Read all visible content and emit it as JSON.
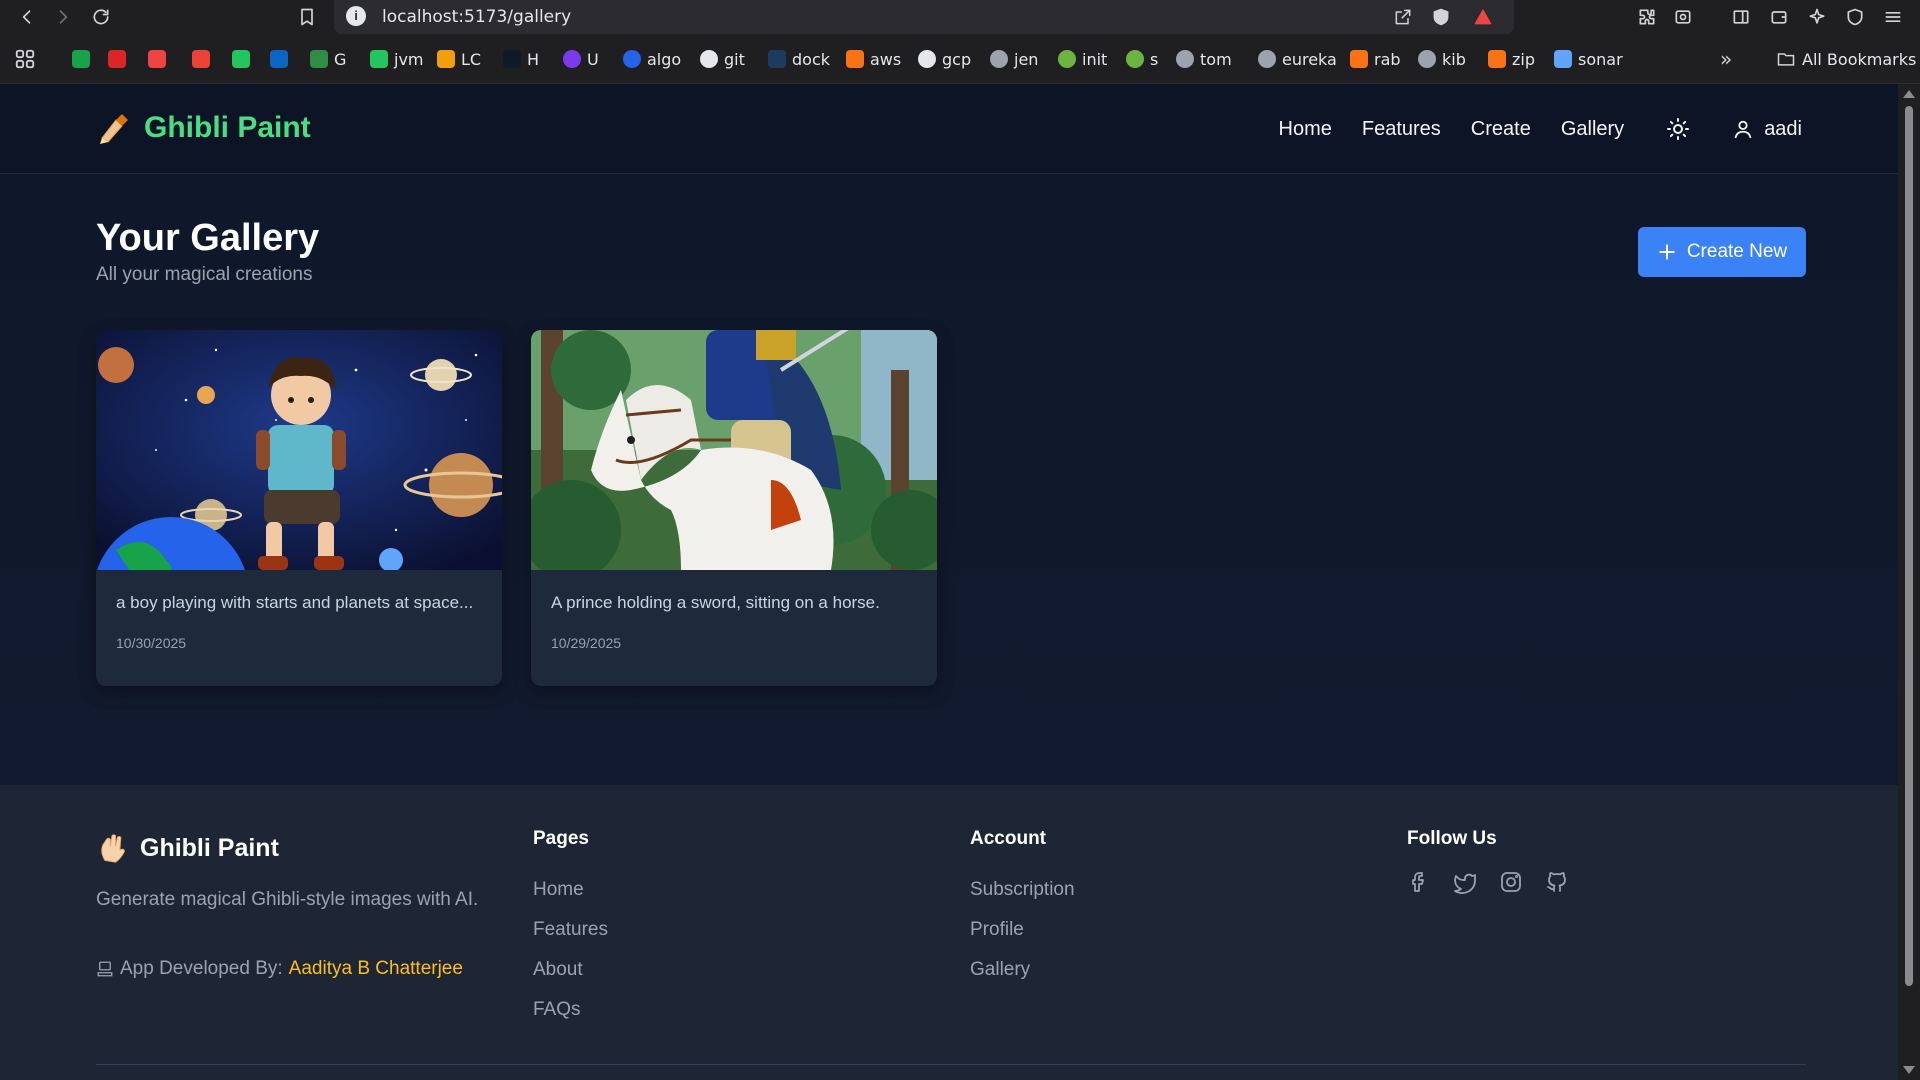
{
  "browser": {
    "url": "localhost:5173/gallery",
    "bookmarks": [
      {
        "label": "",
        "icon": "cb-icon",
        "color": "#16a34a"
      },
      {
        "label": "",
        "icon": "diamond-icon",
        "color": "#dc2626"
      },
      {
        "label": "",
        "icon": "youtube-icon",
        "color": "#ef4444"
      },
      {
        "label": "",
        "icon": "gmail-icon",
        "color": "#ea4335"
      },
      {
        "label": "",
        "icon": "microsoft-icon",
        "color": "#22c55e"
      },
      {
        "label": "",
        "icon": "linkedin-icon",
        "color": "#0a66c2"
      },
      {
        "label": "G",
        "icon": "gfg-icon",
        "color": "#2f8d46"
      },
      {
        "label": "jvm",
        "icon": "jvm-icon",
        "color": "#22c55e"
      },
      {
        "label": "LC",
        "icon": "leetcode-icon",
        "color": "#f59e0b"
      },
      {
        "label": "H",
        "icon": "hackerrank-icon",
        "color": "#111827"
      },
      {
        "label": "U",
        "icon": "udemy-icon",
        "color": "#7c3aed"
      },
      {
        "label": "algo",
        "icon": "algo-icon",
        "color": "#2563eb"
      },
      {
        "label": "git",
        "icon": "github-icon",
        "color": "#e5e7eb"
      },
      {
        "label": "dock",
        "icon": "docker-icon",
        "color": "#1e3a5f"
      },
      {
        "label": "aws",
        "icon": "aws-icon",
        "color": "#f97316"
      },
      {
        "label": "gcp",
        "icon": "google-icon",
        "color": "#e5e7eb"
      },
      {
        "label": "jen",
        "icon": "globe-icon",
        "color": "#9ca3af"
      },
      {
        "label": "init",
        "icon": "spring-icon",
        "color": "#6db33f"
      },
      {
        "label": "s",
        "icon": "spring-icon",
        "color": "#6db33f"
      },
      {
        "label": "tom",
        "icon": "globe-icon",
        "color": "#9ca3af"
      },
      {
        "label": "eureka",
        "icon": "globe-icon",
        "color": "#9ca3af"
      },
      {
        "label": "rab",
        "icon": "rabbitmq-icon",
        "color": "#f97316"
      },
      {
        "label": "kib",
        "icon": "kibana-icon",
        "color": "#9ca3af"
      },
      {
        "label": "zip",
        "icon": "zipkin-icon",
        "color": "#f97316"
      },
      {
        "label": "sonar",
        "icon": "sonar-icon",
        "color": "#60a5fa"
      }
    ],
    "all_bookmarks": "All Bookmarks"
  },
  "header": {
    "brand": "Ghibli Paint",
    "nav": [
      "Home",
      "Features",
      "Create",
      "Gallery"
    ],
    "user": "aadi"
  },
  "main": {
    "title": "Your Gallery",
    "subtitle": "All your magical creations",
    "create_button": "Create New",
    "cards": [
      {
        "description": "a boy playing with starts and planets at space...",
        "date": "10/30/2025"
      },
      {
        "description": "A prince holding a sword, sitting on a horse.",
        "date": "10/29/2025"
      }
    ]
  },
  "footer": {
    "brand": "Ghibli Paint",
    "description": "Generate magical Ghibli-style images with AI.",
    "developed_by_label": "App Developed By:",
    "developer": "Aaditya B Chatterjee",
    "pages_heading": "Pages",
    "pages": [
      "Home",
      "Features",
      "About",
      "FAQs"
    ],
    "account_heading": "Account",
    "account": [
      "Subscription",
      "Profile",
      "Gallery"
    ],
    "follow_heading": "Follow Us",
    "social": [
      "facebook-icon",
      "twitter-icon",
      "instagram-icon",
      "github-icon"
    ]
  },
  "colors": {
    "brand_green": "#4ade80",
    "accent_blue": "#3b82f6",
    "developer_link": "#fbbf24",
    "page_bg": "#0f172a",
    "card_bg": "#1e293b",
    "footer_bg": "#1e2535"
  }
}
